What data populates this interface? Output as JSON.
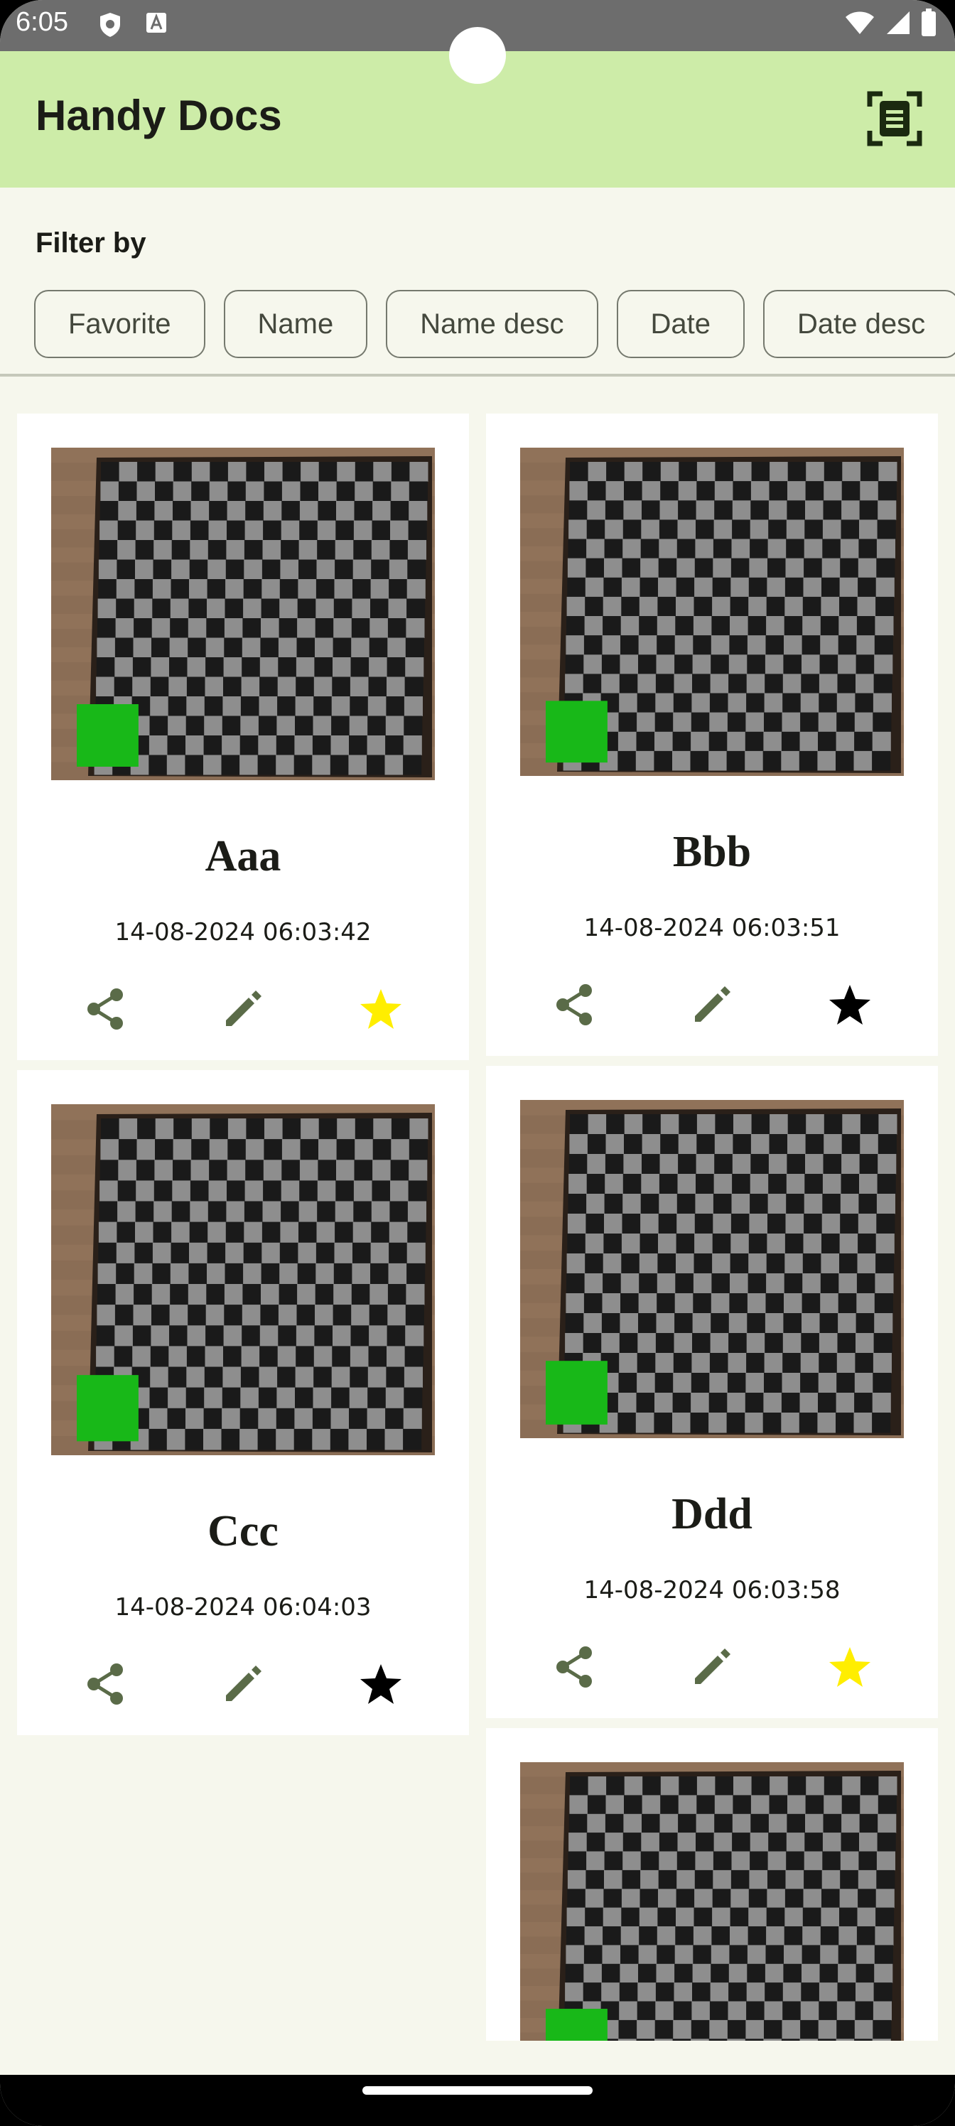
{
  "status_bar": {
    "time": "6:05"
  },
  "app_bar": {
    "title": "Handy Docs",
    "scan_icon": "document-scanner-icon"
  },
  "filter": {
    "label": "Filter by",
    "chips": [
      "Favorite",
      "Name",
      "Name desc",
      "Date",
      "Date desc"
    ]
  },
  "colors": {
    "accent": "#cdeca8",
    "action_icon": "#5a6b48",
    "star_favorite": "#ffee00",
    "star_normal": "#000000"
  },
  "documents": [
    {
      "title": "Aaa",
      "date": "14-08-2024 06:03:42",
      "favorite": true
    },
    {
      "title": "Bbb",
      "date": "14-08-2024 06:03:51",
      "favorite": false
    },
    {
      "title": "Ccc",
      "date": "14-08-2024 06:04:03",
      "favorite": false
    },
    {
      "title": "Ddd",
      "date": "14-08-2024 06:03:58",
      "favorite": true
    }
  ]
}
